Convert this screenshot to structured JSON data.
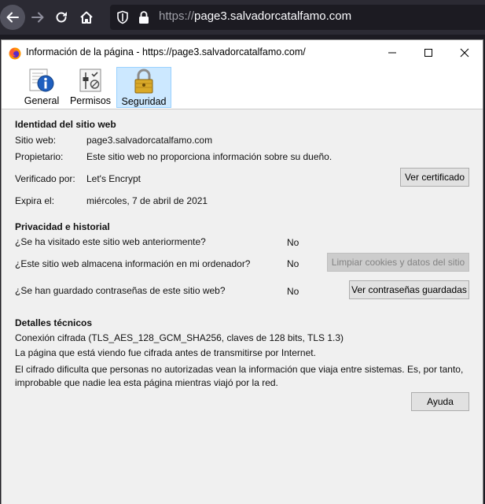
{
  "browser": {
    "url_prefix": "https://",
    "url_host": "page3.salvadorcatalfamo.com"
  },
  "dialog": {
    "title": "Información de la página - https://page3.salvadorcatalfamo.com/",
    "tabs": [
      {
        "label": "General",
        "icon": "info-icon"
      },
      {
        "label": "Permisos",
        "icon": "permissions-icon"
      },
      {
        "label": "Seguridad",
        "icon": "padlock-icon",
        "selected": true
      }
    ],
    "identity": {
      "heading": "Identidad del sitio web",
      "site_label": "Sitio web:",
      "site_value": "page3.salvadorcatalfamo.com",
      "owner_label": "Propietario:",
      "owner_value": "Este sitio web no proporciona información sobre su dueño.",
      "verified_label": "Verificado por:",
      "verified_value": "Let's Encrypt",
      "expires_label": "Expira el:",
      "expires_value": "miércoles, 7 de abril de 2021",
      "view_cert_button": "Ver certificado"
    },
    "privacy": {
      "heading": "Privacidad e historial",
      "q1": "¿Se ha visitado este sitio web anteriormente?",
      "a1": "No",
      "q2": "¿Este sitio web almacena información en mi ordenador?",
      "a2": "No",
      "clear_button": "Limpiar cookies y datos del sitio",
      "q3": "¿Se han guardado contraseñas de este sitio web?",
      "a3": "No",
      "passwords_button": "Ver contraseñas guardadas"
    },
    "technical": {
      "heading": "Detalles técnicos",
      "line1": "Conexión cifrada (TLS_AES_128_GCM_SHA256, claves de 128 bits, TLS 1.3)",
      "line2": "La página que está viendo fue cifrada antes de transmitirse por Internet.",
      "line3": "El cifrado dificulta que personas no autorizadas vean la información que viaja entre sistemas. Es, por tanto,",
      "line4": "improbable que nadie lea esta página mientras viajó por la red."
    },
    "help_button": "Ayuda"
  },
  "colors": {
    "browser_chrome": "#2b2a33",
    "dialog_bg": "#f0f0f0",
    "selected_tab": "#cce8ff"
  }
}
